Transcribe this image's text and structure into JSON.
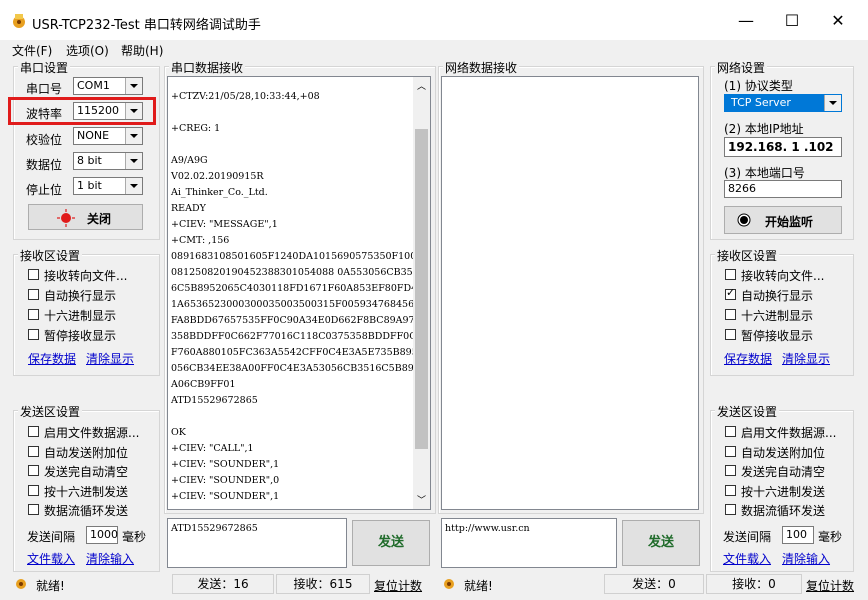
{
  "window": {
    "title": "USR-TCP232-Test 串口转网络调试助手",
    "minimize": "—",
    "maximize": "☐",
    "close": "✕"
  },
  "menu": [
    "文件(F)",
    "选项(O)",
    "帮助(H)"
  ],
  "serial_settings": {
    "group": "串口设置",
    "port_label": "串口号",
    "port_value": "COM1",
    "baud_label": "波特率",
    "baud_value": "115200",
    "parity_label": "校验位",
    "parity_value": "NONE",
    "data_label": "数据位",
    "data_value": "8 bit",
    "stop_label": "停止位",
    "stop_value": "1 bit",
    "close_button": "关闭"
  },
  "serial_rx_settings": {
    "group": "接收区设置",
    "options": [
      {
        "label": "接收转向文件...",
        "checked": false
      },
      {
        "label": "自动换行显示",
        "checked": false
      },
      {
        "label": "十六进制显示",
        "checked": false
      },
      {
        "label": "暂停接收显示",
        "checked": false
      }
    ],
    "save": "保存数据",
    "clear": "清除显示"
  },
  "serial_tx_settings": {
    "group": "发送区设置",
    "options": [
      {
        "label": "启用文件数据源...",
        "checked": false
      },
      {
        "label": "自动发送附加位",
        "checked": false
      },
      {
        "label": "发送完自动清空",
        "checked": false
      },
      {
        "label": "按十六进制发送",
        "checked": false
      },
      {
        "label": "数据流循环发送",
        "checked": false
      }
    ],
    "interval_label": "发送间隔",
    "interval_value": "1000",
    "interval_unit": "毫秒",
    "load_file": "文件载入",
    "clear_input": "清除输入"
  },
  "serial_rx": {
    "group": "串口数据接收",
    "lines": [
      "+CTZV:21/05/28,10:33:44,+08",
      "",
      "+CREG: 1",
      "",
      "A9/A9G",
      "V02.02.20190915R",
      "Ai_Thinker_Co._Ltd.",
      "READY",
      "+CIEV: \"MESSAGE\",1",
      "+CMT: ,156",
      "0891683108501605F1240DA1015690575350F100",
      "081250820190452388301054088 0A553056CB351",
      "6C5B8952065C4030118FD1671F60A853EF80FD4F",
      "1A6536523000300035003500315F005934768456",
      "FA8BDD67657535FF0C90A34E0D662F8BC89A9775",
      "358BDDFF0C662F77016C118C0375358BDDFF0C8B",
      "F760A880105FC363A5542CFF0C4E3A5E735B8953",
      "056CB34EE38A00FF0C4E3A53056CB3516C5B8952",
      "A06CB9FF01",
      "ATD15529672865",
      "",
      "OK",
      "+CIEV: \"CALL\",1",
      "+CIEV: \"SOUNDER\",1",
      "+CIEV: \"SOUNDER\",0",
      "+CIEV: \"SOUNDER\",1"
    ]
  },
  "serial_tx": {
    "input": "ATD15529672865",
    "send": "发送"
  },
  "net_rx": {
    "group": "网络数据接收"
  },
  "net_tx": {
    "input": "http://www.usr.cn",
    "send": "发送"
  },
  "net_settings": {
    "group": "网络设置",
    "protocol_label": "(1) 协议类型",
    "protocol_value": "TCP Server",
    "ip_label": "(2) 本地IP地址",
    "ip_value": "192.168. 1 .102",
    "port_label": "(3) 本地端口号",
    "port_value": "8266",
    "listen_button": "开始监听"
  },
  "net_rx_settings": {
    "group": "接收区设置",
    "options": [
      {
        "label": "接收转向文件...",
        "checked": false
      },
      {
        "label": "自动换行显示",
        "checked": true
      },
      {
        "label": "十六进制显示",
        "checked": false
      },
      {
        "label": "暂停接收显示",
        "checked": false
      }
    ],
    "save": "保存数据",
    "clear": "清除显示"
  },
  "net_tx_settings": {
    "group": "发送区设置",
    "options": [
      {
        "label": "启用文件数据源...",
        "checked": false
      },
      {
        "label": "自动发送附加位",
        "checked": false
      },
      {
        "label": "发送完自动清空",
        "checked": false
      },
      {
        "label": "按十六进制发送",
        "checked": false
      },
      {
        "label": "数据流循环发送",
        "checked": false
      }
    ],
    "interval_label": "发送间隔",
    "interval_value": "100",
    "interval_unit": "毫秒",
    "load_file": "文件载入",
    "clear_input": "清除输入"
  },
  "statusbar": {
    "left_status": "就绪!",
    "left_send": "发送：16",
    "left_recv": "接收：615",
    "left_reset": "复位计数",
    "right_status": "就绪!",
    "right_send": "发送：0",
    "right_recv": "接收：0",
    "right_reset": "复位计数"
  },
  "colors": {
    "highlight": "#e01b1b",
    "selection": "#0078d7",
    "link": "#0000cc"
  }
}
